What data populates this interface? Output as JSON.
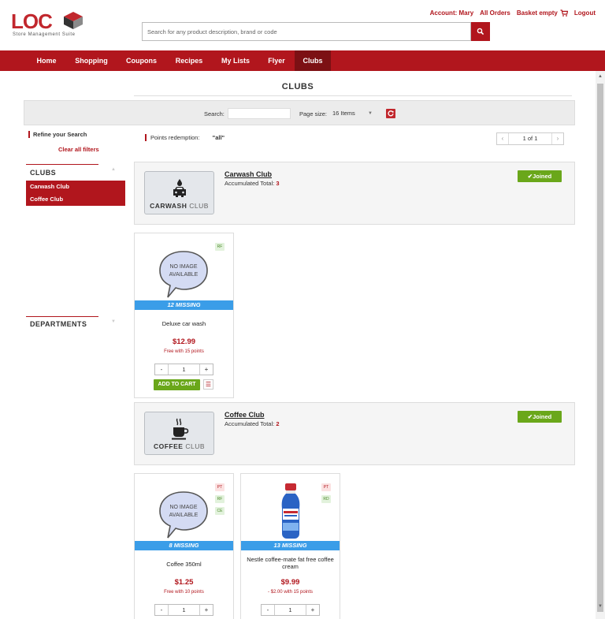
{
  "header": {
    "logo_text": "LOC",
    "logo_sub": "Store Management Suite",
    "search_placeholder": "Search for any product description, brand or code",
    "account": "Account: Mary",
    "all_orders": "All Orders",
    "basket": "Basket empty",
    "logout": "Logout"
  },
  "nav": {
    "items": [
      "Home",
      "Shopping",
      "Coupons",
      "Recipes",
      "My Lists",
      "Flyer",
      "Clubs"
    ],
    "active": "Clubs"
  },
  "page": {
    "title": "CLUBS"
  },
  "search_bar": {
    "search_label": "Search:",
    "page_size_label": "Page size:",
    "page_size_value": "16 Items"
  },
  "sidebar": {
    "refine": "Refine your Search",
    "clear_filters": "Clear all filters",
    "clubs_heading": "CLUBS",
    "clubs": [
      "Carwash Club",
      "Coffee Club"
    ],
    "departments_heading": "DEPARTMENTS"
  },
  "filter": {
    "points_label": "Points redemption:",
    "points_value": "\"all\""
  },
  "pager": {
    "label": "1 of 1"
  },
  "clubs": [
    {
      "name": "Carwash Club",
      "total_label": "Accumulated Total:",
      "total": "3",
      "logo_bold": "CARWASH",
      "logo_light": "CLUB",
      "status": "Joined",
      "products": [
        {
          "badges": [
            "RF"
          ],
          "missing": "12 MISSING",
          "name": "Deluxe car wash",
          "price": "$12.99",
          "promo": "Free with 15 points",
          "qty": "1",
          "add_label": "ADD TO CART"
        }
      ]
    },
    {
      "name": "Coffee Club",
      "total_label": "Accumulated Total:",
      "total": "2",
      "logo_bold": "COFFEE",
      "logo_light": "CLUB",
      "status": "Joined",
      "products": [
        {
          "badges": [
            "PT",
            "RF",
            "CE"
          ],
          "missing": "8 MISSING",
          "name": "Coffee 350ml",
          "price": "$1.25",
          "promo": "Free with 10 points",
          "qty": "1"
        },
        {
          "badges": [
            "PT",
            "RD"
          ],
          "missing": "13 MISSING",
          "name": "Nestle coffee-mate fat free coffee cream",
          "price": "$9.99",
          "promo": "- $2.00 with 15 points",
          "qty": "1"
        }
      ]
    }
  ],
  "no_image_text": [
    "NO IMAGE",
    "AVAILABLE"
  ],
  "colors": {
    "brand_red": "#b1161d",
    "nav_active": "#7c1014",
    "joined_green": "#6aa71a",
    "missing_blue": "#3a9de8"
  }
}
